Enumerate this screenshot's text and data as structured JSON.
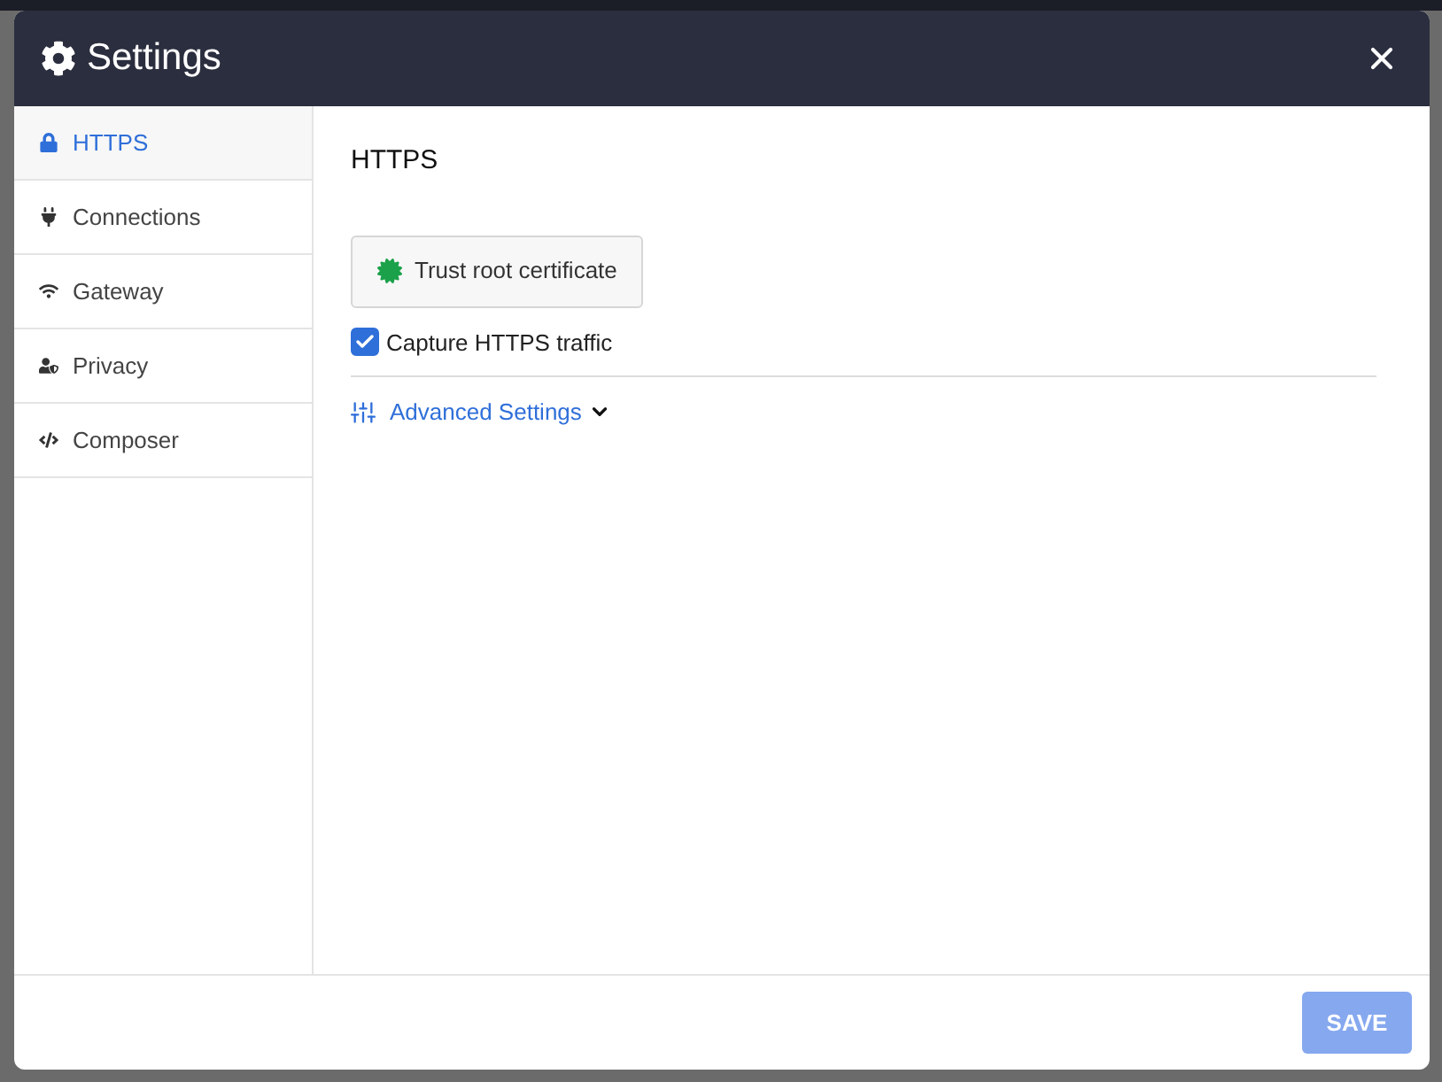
{
  "dialog": {
    "title": "Settings"
  },
  "sidebar": {
    "items": [
      {
        "label": "HTTPS",
        "selected": true
      },
      {
        "label": "Connections",
        "selected": false
      },
      {
        "label": "Gateway",
        "selected": false
      },
      {
        "label": "Privacy",
        "selected": false
      },
      {
        "label": "Composer",
        "selected": false
      }
    ]
  },
  "content": {
    "heading": "HTTPS",
    "trust_button": "Trust root certificate",
    "capture": {
      "label": "Capture HTTPS traffic",
      "checked": true
    },
    "advanced": {
      "label": "Advanced Settings",
      "expanded": false
    }
  },
  "footer": {
    "save_button": {
      "label": "SAVE",
      "disabled": true
    }
  }
}
